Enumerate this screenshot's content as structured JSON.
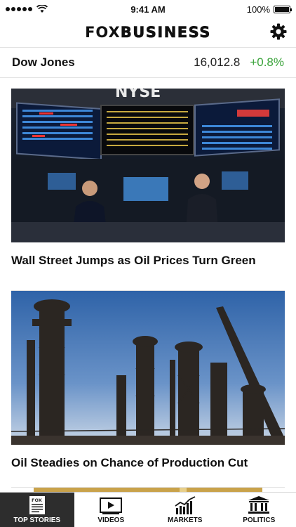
{
  "status_bar": {
    "time": "9:41 AM",
    "battery": "100%",
    "signal_icon": "signal-dots-icon",
    "wifi_icon": "wifi-icon",
    "battery_icon": "battery-icon"
  },
  "header": {
    "logo_fox": "FOX",
    "logo_business": "BUSINESS",
    "settings_icon": "gear-icon"
  },
  "ticker": {
    "name": "Dow Jones",
    "value": "16,012.8",
    "change": "+0.8%",
    "change_color": "#3aa33a"
  },
  "articles": [
    {
      "headline": "Wall Street Jumps as Oil Prices Turn Green",
      "image": "nyse-trading-floor"
    },
    {
      "headline": "Oil Steadies on Chance of Production Cut",
      "image": "oil-refinery-towers"
    },
    {
      "headline": "",
      "image": "partial-thumbnail"
    }
  ],
  "tabs": [
    {
      "label": "TOP STORIES",
      "icon": "newspaper-icon",
      "active": true
    },
    {
      "label": "VIDEOS",
      "icon": "play-icon",
      "active": false
    },
    {
      "label": "MARKETS",
      "icon": "bar-chart-icon",
      "active": false
    },
    {
      "label": "POLITICS",
      "icon": "capitol-icon",
      "active": false
    }
  ],
  "colors": {
    "accent_green": "#3aa33a",
    "tab_active_bg": "#2d2d2d",
    "divider": "#e2e2e2"
  }
}
